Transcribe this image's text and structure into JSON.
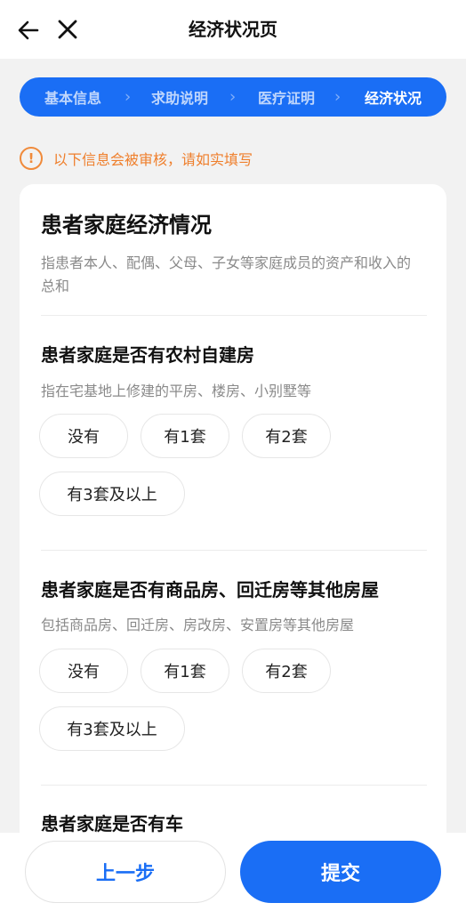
{
  "header": {
    "title": "经济状况页"
  },
  "steps": [
    "基本信息",
    "求助说明",
    "医疗证明",
    "经济状况"
  ],
  "notice": {
    "text": "以下信息会被审核，请如实填写"
  },
  "card": {
    "title": "患者家庭经济情况",
    "desc": "指患者本人、配偶、父母、子女等家庭成员的资产和收入的总和"
  },
  "questions": [
    {
      "title": "患者家庭是否有农村自建房",
      "desc": "指在宅基地上修建的平房、楼房、小别墅等",
      "options": [
        "没有",
        "有1套",
        "有2套",
        "有3套及以上"
      ]
    },
    {
      "title": "患者家庭是否有商品房、回迁房等其他房屋",
      "desc": "包括商品房、回迁房、房改房、安置房等其他房屋",
      "options": [
        "没有",
        "有1套",
        "有2套",
        "有3套及以上"
      ]
    },
    {
      "title": "患者家庭是否有车"
    }
  ],
  "footer": {
    "prev_label": "上一步",
    "submit_label": "提交"
  }
}
